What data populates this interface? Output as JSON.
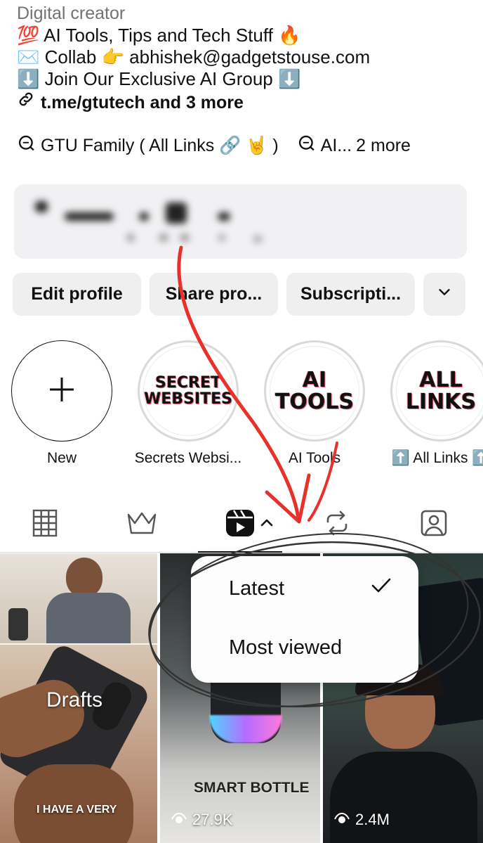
{
  "bio": {
    "category": "Digital creator",
    "lines": [
      {
        "emoji": "💯",
        "text": "AI Tools, Tips and Tech Stuff",
        "trail": "🔥"
      },
      {
        "emoji": "✉️",
        "text": "Collab",
        "trail": "👉 abhishek@gadgetstouse.com"
      },
      {
        "emoji": "⬇️",
        "text": "Join Our Exclusive AI Group",
        "trail": "⬇️"
      }
    ],
    "link_text": "t.me/gtutech and 3 more"
  },
  "channels": [
    {
      "label": "GTU Family ( All Links 🔗 🤘 )"
    },
    {
      "label": "AI...",
      "more": "2 more"
    }
  ],
  "actions": {
    "edit": "Edit profile",
    "share": "Share pro...",
    "subscriptions": "Subscripti..."
  },
  "highlights": [
    {
      "cover": "",
      "label": "New"
    },
    {
      "cover": "SECRET\nWEBSITES",
      "label": "Secrets Websi..."
    },
    {
      "cover": "AI\nTOOLS",
      "label": "AI Tools"
    },
    {
      "cover": "ALL\nLINKS",
      "label": "⬆️ All Links ⬆️"
    }
  ],
  "tabs": [
    {
      "icon": "grid-icon"
    },
    {
      "icon": "crown-icon"
    },
    {
      "icon": "reels-icon",
      "active": true
    },
    {
      "icon": "reposts-icon"
    },
    {
      "icon": "tagged-icon"
    }
  ],
  "sort_menu": {
    "options": [
      "Latest",
      "Most viewed"
    ],
    "selected": "Latest"
  },
  "reels": [
    {
      "overlay_title": "Drafts",
      "caption": "I HAVE A VERY"
    },
    {
      "caption": "SMART BOTTLE",
      "views": "27.9K"
    },
    {
      "views": "2.4M"
    }
  ],
  "colors": {
    "annotation_red": "#e8312b",
    "button_bg": "#efefef",
    "muted_text": "#737373"
  }
}
